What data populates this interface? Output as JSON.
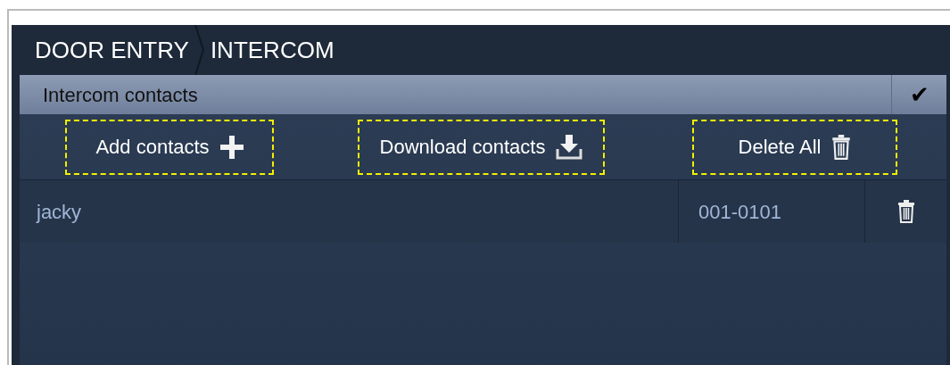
{
  "breadcrumb": [
    "DOOR ENTRY",
    "INTERCOM"
  ],
  "section": {
    "title": "Intercom contacts",
    "confirm": "✔"
  },
  "actions": [
    {
      "label": "Add contacts",
      "kind": "add"
    },
    {
      "label": "Download contacts",
      "kind": "download"
    },
    {
      "label": "Delete All",
      "kind": "delete"
    }
  ],
  "contacts": [
    {
      "name": "jacky",
      "number": "001-0101"
    }
  ]
}
